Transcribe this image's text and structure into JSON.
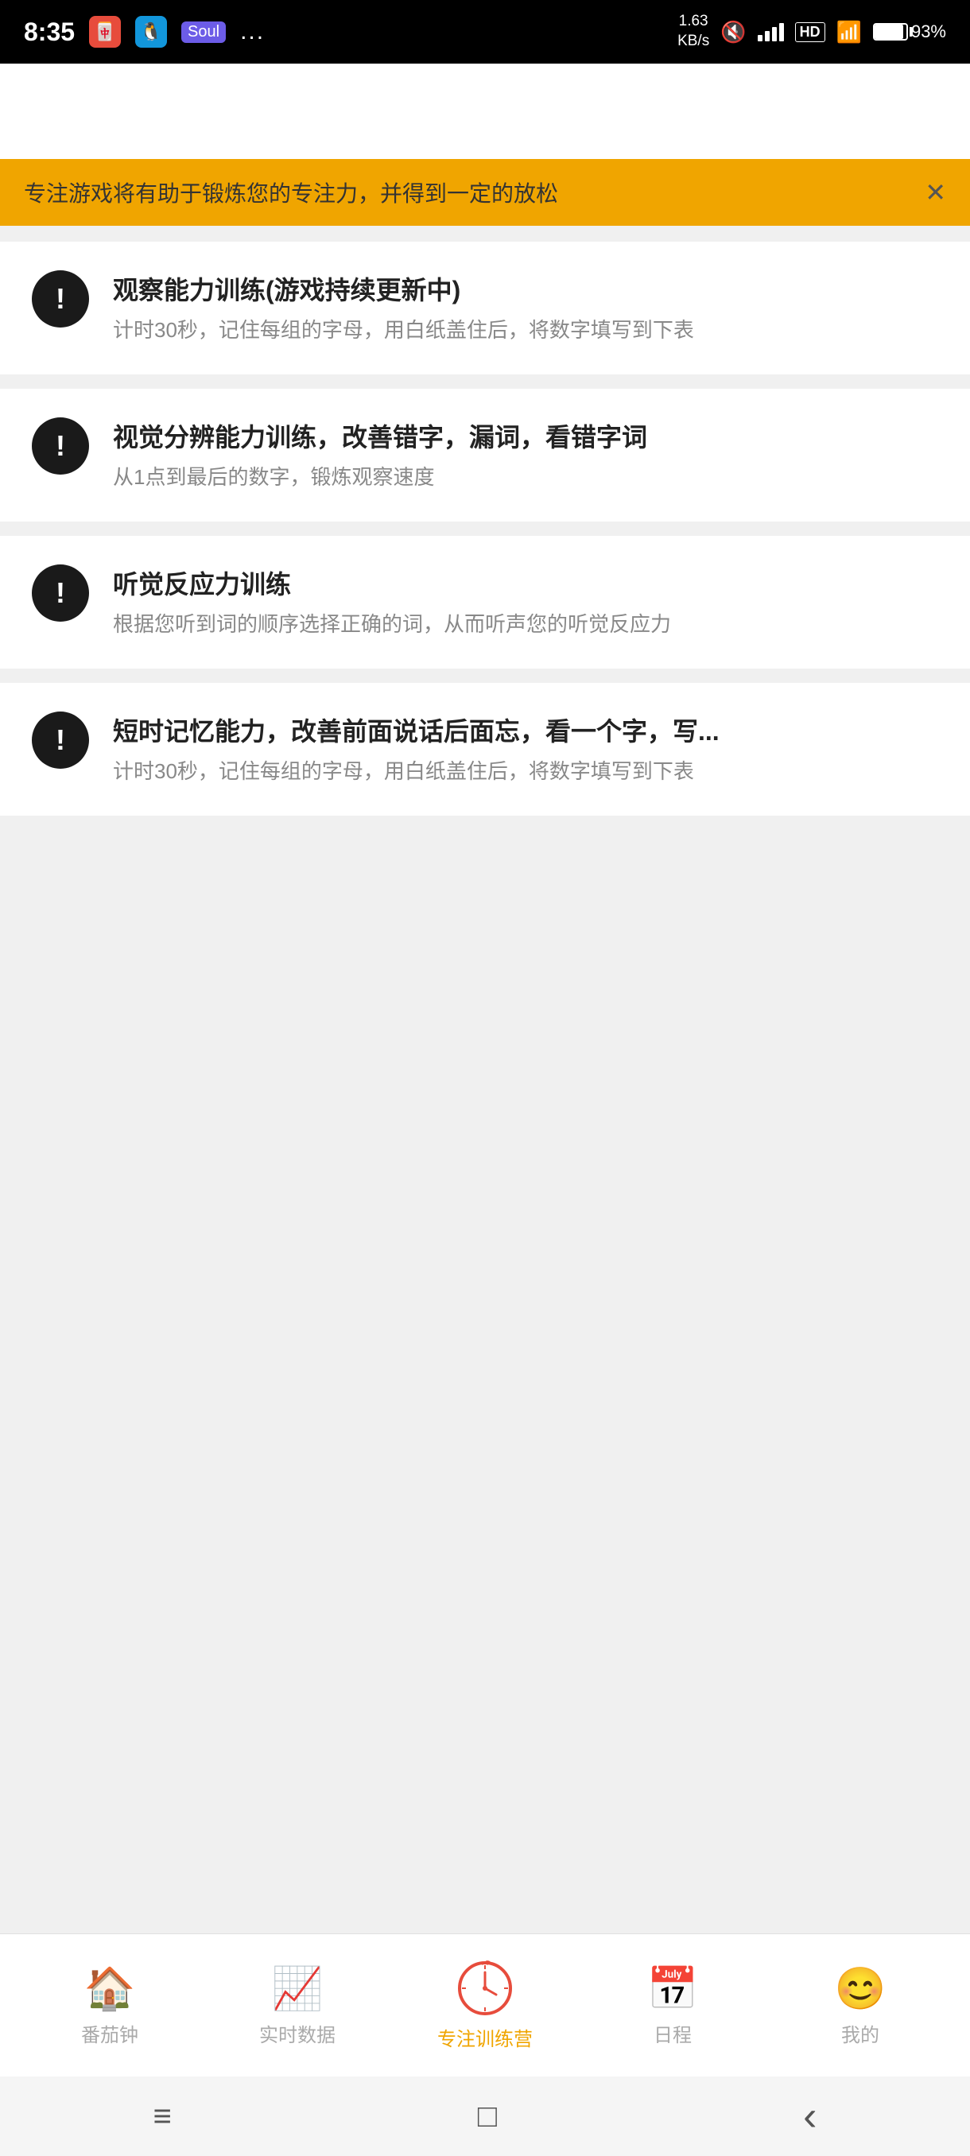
{
  "statusBar": {
    "time": "8:35",
    "networkSpeed": "1.63\nKB/s",
    "batteryPercent": "93%",
    "appIcon1": "🀄",
    "appIcon2": "🐧",
    "soulLabel": "Soul",
    "moreLabel": "..."
  },
  "banner": {
    "text": "专注游戏将有助于锻炼您的专注力，并得到一定的放松",
    "closeIcon": "✕"
  },
  "cards": [
    {
      "id": "card-1",
      "icon": "!",
      "title": "观察能力训练(游戏持续更新中)",
      "desc": "计时30秒，记住每组的字母，用白纸盖住后，将数字填写到下表"
    },
    {
      "id": "card-2",
      "icon": "!",
      "title": "视觉分辨能力训练，改善错字，漏词，看错字词",
      "desc": "从1点到最后的数字，锻炼观察速度"
    },
    {
      "id": "card-3",
      "icon": "!",
      "title": "听觉反应力训练",
      "desc": "根据您听到词的顺序选择正确的词，从而听声您的听觉反应力"
    },
    {
      "id": "card-4",
      "icon": "!",
      "title": "短时记忆能力，改善前面说话后面忘，看一个字，写...",
      "desc": "计时30秒，记住每组的字母，用白纸盖住后，将数字填写到下表"
    }
  ],
  "bottomNav": {
    "items": [
      {
        "id": "pomodoro",
        "label": "番茄钟",
        "icon": "🏠",
        "active": false
      },
      {
        "id": "realtime",
        "label": "实时数据",
        "icon": "📈",
        "active": false
      },
      {
        "id": "training",
        "label": "专注训练营",
        "icon": "⏰",
        "active": true
      },
      {
        "id": "schedule",
        "label": "日程",
        "icon": "📅",
        "active": false
      },
      {
        "id": "mine",
        "label": "我的",
        "icon": "😊",
        "active": false
      }
    ]
  },
  "systemNav": {
    "menuIcon": "≡",
    "homeIcon": "□",
    "backIcon": "‹"
  }
}
